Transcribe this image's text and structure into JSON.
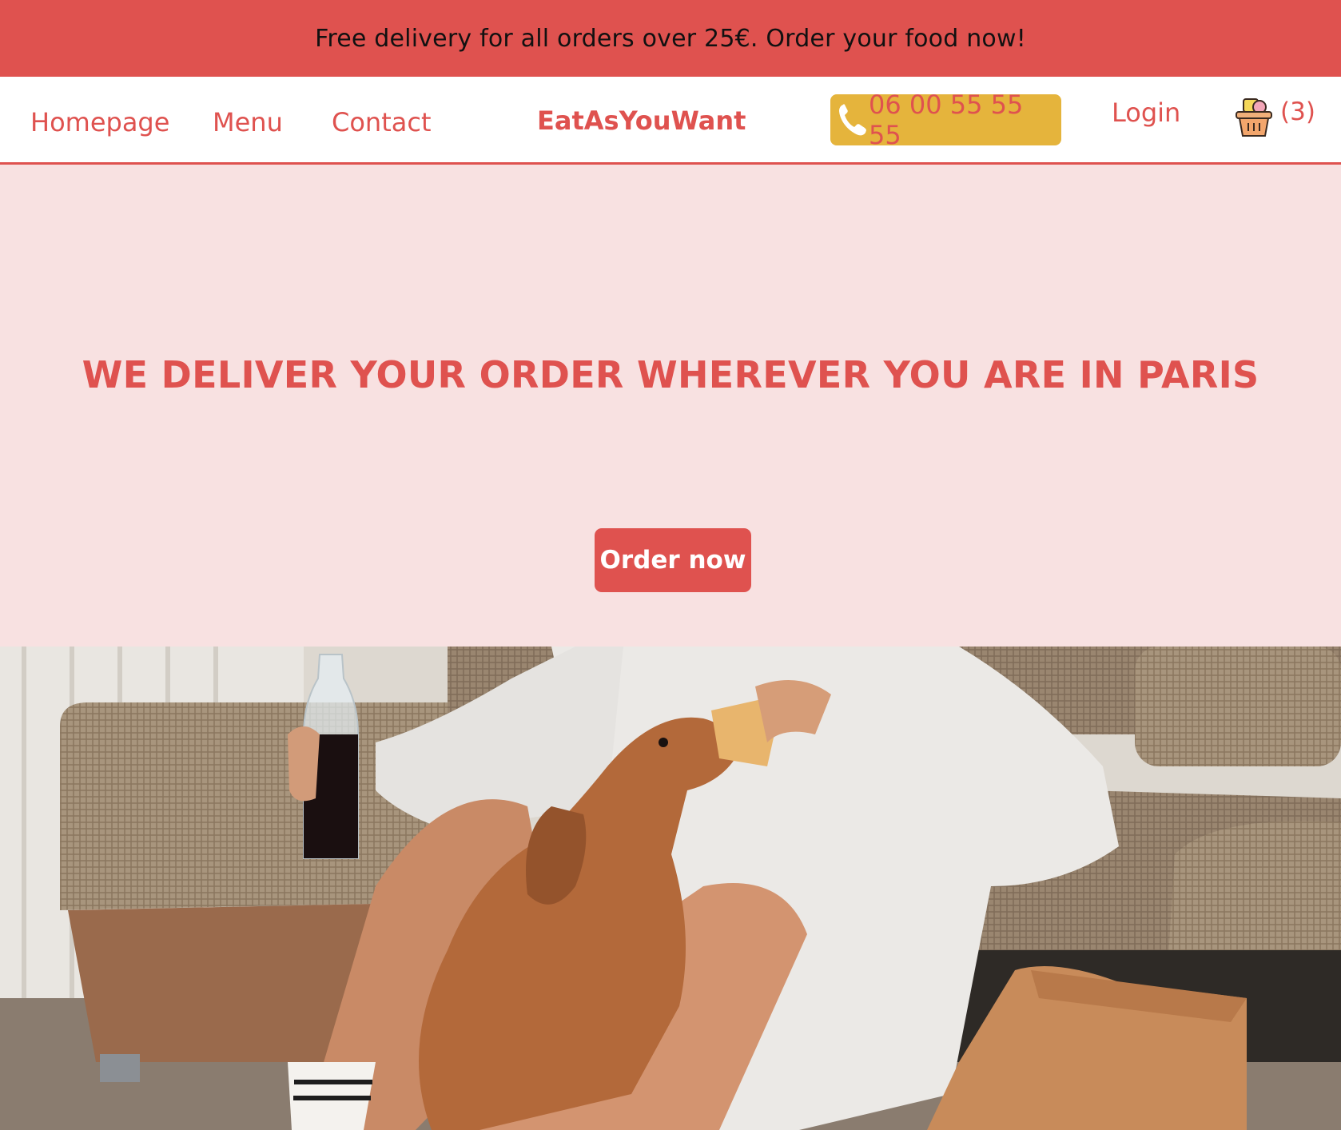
{
  "promo": {
    "text": "Free delivery for all orders over 25€. Order your food now!"
  },
  "nav": {
    "links": [
      {
        "label": "Homepage"
      },
      {
        "label": "Menu"
      },
      {
        "label": "Contact"
      }
    ],
    "brand": "EatAsYouWant",
    "phone": {
      "number": "06 00 55 55 55",
      "icon": "phone-icon"
    },
    "login_label": "Login",
    "cart": {
      "icon": "basket-icon",
      "count": "(3)"
    }
  },
  "hero": {
    "title": "WE DELIVER YOUR ORDER WHEREVER YOU ARE IN PARIS",
    "cta_label": "Order now"
  },
  "colors": {
    "accent": "#df524f",
    "hero_bg": "#f8e1e1",
    "phone_bg": "#e5b43c",
    "text_dark": "#111111"
  }
}
